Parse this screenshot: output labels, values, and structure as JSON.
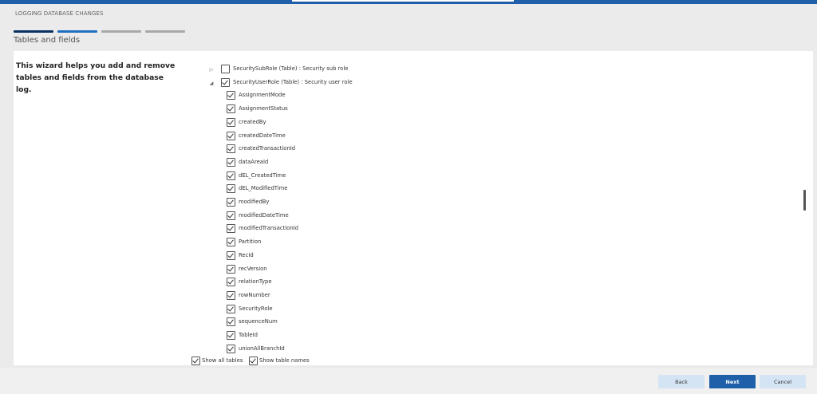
{
  "wizard": {
    "header": "LOGGING DATABASE CHANGES",
    "title": "Tables and fields",
    "intro": "This wizard helps you add and remove tables and fields from the database log.",
    "steps": [
      {
        "state": "completed"
      },
      {
        "state": "current"
      },
      {
        "state": "pending"
      },
      {
        "state": "pending"
      }
    ]
  },
  "tree": {
    "tables": [
      {
        "label": "SecuritySubRole (Table) : Security sub role",
        "expanded": false,
        "checked": false
      },
      {
        "label": "SecurityUserRole (Table) : Security user role",
        "expanded": true,
        "checked": true
      }
    ],
    "fields": [
      {
        "label": "AssignmentMode",
        "checked": true
      },
      {
        "label": "AssignmentStatus",
        "checked": true
      },
      {
        "label": "createdBy",
        "checked": true
      },
      {
        "label": "createdDateTime",
        "checked": true
      },
      {
        "label": "createdTransactionId",
        "checked": true
      },
      {
        "label": "dataAreaId",
        "checked": true
      },
      {
        "label": "dEL_CreatedTime",
        "checked": true
      },
      {
        "label": "dEL_ModifiedTime",
        "checked": true
      },
      {
        "label": "modifiedBy",
        "checked": true
      },
      {
        "label": "modifiedDateTime",
        "checked": true
      },
      {
        "label": "modifiedTransactionId",
        "checked": true
      },
      {
        "label": "Partition",
        "checked": true
      },
      {
        "label": "RecId",
        "checked": true
      },
      {
        "label": "recVersion",
        "checked": true
      },
      {
        "label": "relationType",
        "checked": true
      },
      {
        "label": "rowNumber",
        "checked": true
      },
      {
        "label": "SecurityRole",
        "checked": true
      },
      {
        "label": "sequenceNum",
        "checked": true
      },
      {
        "label": "TableId",
        "checked": true
      },
      {
        "label": "unionAllBranchId",
        "checked": true
      }
    ]
  },
  "options": {
    "show_all_tables": {
      "label": "Show all tables",
      "checked": true
    },
    "show_table_names": {
      "label": "Show table names",
      "checked": true
    }
  },
  "buttons": {
    "back": "Back",
    "next": "Next",
    "cancel": "Cancel"
  },
  "icons": {
    "collapsed": "triangle-right-icon",
    "expanded": "triangle-down-icon",
    "checkbox": "checkbox-icon"
  },
  "colors": {
    "accent": "#1f5fa9",
    "step_completed": "#0a3161",
    "step_current": "#1f6fc0",
    "step_pending": "#a8a8a8"
  }
}
